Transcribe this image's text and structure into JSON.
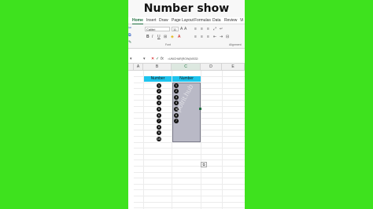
{
  "banner": {
    "title": "Number show"
  },
  "ribbon_tabs": [
    "Home",
    "Insert",
    "Draw",
    "Page Layout",
    "Formulas",
    "Data",
    "Review",
    "Vi"
  ],
  "ribbon": {
    "font_name": "Calibri",
    "font_size": "11",
    "label_font": "Font",
    "label_alignment": "Alignment",
    "bold": "B",
    "italic": "I",
    "underline": "U"
  },
  "formula_bar": {
    "fx": "fx",
    "formula": "=UNICHAR(ROW(A9332:"
  },
  "columns": [
    "A",
    "B",
    "C",
    "D",
    "E"
  ],
  "headers": {
    "b": "Number",
    "c": "Number"
  },
  "numbers_b": [
    "1",
    "2",
    "3",
    "4",
    "5",
    "6",
    "7",
    "8",
    "9",
    "10"
  ],
  "numbers_c": [
    "1",
    "2",
    "3",
    "4",
    "5",
    "6",
    "7"
  ],
  "watermark": "potrit.hub",
  "colors": {
    "background": "#3ee21e",
    "header_fill": "#1ec4ee",
    "selection": "#b9b9c6",
    "accent": "#1e6e3e"
  }
}
